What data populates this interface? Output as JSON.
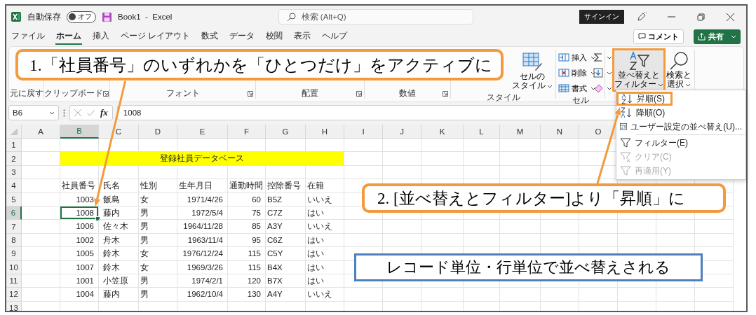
{
  "title_bar": {
    "autosave": {
      "label": "自動保存",
      "on": false,
      "state": "オフ"
    },
    "document_title": "Book1  -  Excel",
    "search": {
      "placeholder": "検索 (Alt+Q)"
    },
    "sign_in": "サインイン"
  },
  "menu_tabs": [
    {
      "label": "ファイル",
      "selected": false
    },
    {
      "label": "ホーム",
      "selected": true
    },
    {
      "label": "挿入",
      "selected": false
    },
    {
      "label": "ページ レイアウト",
      "selected": false
    },
    {
      "label": "数式",
      "selected": false
    },
    {
      "label": "データ",
      "selected": false
    },
    {
      "label": "校閲",
      "selected": false
    },
    {
      "label": "表示",
      "selected": false
    },
    {
      "label": "ヘルプ",
      "selected": false
    }
  ],
  "actions": {
    "comment": "コメント",
    "share": "共有"
  },
  "ribbon": {
    "groups": [
      {
        "label": "元に戻す",
        "launcher": false
      },
      {
        "label": "クリップボード",
        "launcher": true
      },
      {
        "label": "フォント",
        "launcher": true
      },
      {
        "label": "配置",
        "launcher": true
      },
      {
        "label": "数値",
        "launcher": true
      },
      {
        "label": "スタイル",
        "launcher": false,
        "commands": [
          {
            "kind": "large",
            "lines": [
              "セルの",
              "スタイル"
            ],
            "highlighted": false
          }
        ]
      },
      {
        "label": "セル",
        "launcher": false,
        "commands": [
          {
            "kind": "small",
            "label": "挿入",
            "highlighted": false
          },
          {
            "kind": "small",
            "label": "削除",
            "highlighted": false
          },
          {
            "kind": "small",
            "label": "書式",
            "highlighted": false
          }
        ]
      },
      {
        "launcher": false,
        "commands": [
          {
            "kind": "small",
            "highlighted": false
          },
          {
            "kind": "small",
            "highlighted": false
          },
          {
            "kind": "small",
            "highlighted": false
          },
          {
            "kind": "large",
            "lines": [
              "並べ替えと",
              "フィルター"
            ],
            "highlighted": true
          },
          {
            "kind": "large",
            "lines": [
              "検索と",
              "選択"
            ],
            "highlighted": false
          }
        ]
      }
    ]
  },
  "formula_bar": {
    "name_box": "B6",
    "function_label": "fx",
    "value": "1008"
  },
  "sheet": {
    "columns": [
      {
        "label": "A",
        "selected": false
      },
      {
        "label": "B",
        "selected": true
      },
      {
        "label": "C",
        "selected": false
      },
      {
        "label": "D",
        "selected": false
      },
      {
        "label": "E",
        "selected": false
      },
      {
        "label": "F",
        "selected": false
      },
      {
        "label": "G",
        "selected": false
      },
      {
        "label": "H",
        "selected": false
      },
      {
        "label": "I",
        "selected": false
      },
      {
        "label": "J",
        "selected": false
      },
      {
        "label": "K",
        "selected": false
      },
      {
        "label": "L",
        "selected": false
      },
      {
        "label": "M",
        "selected": false
      },
      {
        "label": "N",
        "selected": false
      },
      {
        "label": "O",
        "selected": false
      }
    ],
    "rows": [
      {
        "number": "1",
        "kind": "blank",
        "selected": false
      },
      {
        "number": "2",
        "kind": "title",
        "selected": false,
        "text": "登録社員データベース"
      },
      {
        "number": "3",
        "kind": "blank",
        "selected": false
      },
      {
        "number": "4",
        "kind": "header",
        "selected": false,
        "cells": [
          "社員番号",
          "氏名",
          "性別",
          "生年月日",
          "通勤時間",
          "控除番号",
          "在籍"
        ]
      },
      {
        "number": "5",
        "kind": "record",
        "selected": false,
        "cells": [
          "1003",
          "飯島",
          "女",
          "1971/4/26",
          "60",
          "B5Z",
          "いいえ"
        ]
      },
      {
        "number": "6",
        "kind": "record",
        "selected": true,
        "cells": [
          "1008",
          "藤内",
          "男",
          "1972/5/4",
          "75",
          "C7Z",
          "はい"
        ]
      },
      {
        "number": "7",
        "kind": "record",
        "selected": false,
        "cells": [
          "1006",
          "佐々木",
          "男",
          "1964/11/28",
          "85",
          "A3Y",
          "いいえ"
        ]
      },
      {
        "number": "8",
        "kind": "record",
        "selected": false,
        "cells": [
          "1002",
          "舟木",
          "男",
          "1963/11/4",
          "95",
          "C6Z",
          "はい"
        ]
      },
      {
        "number": "9",
        "kind": "record",
        "selected": false,
        "cells": [
          "1005",
          "鈴木",
          "女",
          "1976/12/24",
          "115",
          "C5Y",
          "はい"
        ]
      },
      {
        "number": "10",
        "kind": "record",
        "selected": false,
        "cells": [
          "1007",
          "鈴木",
          "女",
          "1969/3/26",
          "115",
          "B4X",
          "はい"
        ]
      },
      {
        "number": "11",
        "kind": "record",
        "selected": false,
        "cells": [
          "1001",
          "小笠原",
          "男",
          "1974/2/1",
          "120",
          "B7X",
          "はい"
        ]
      },
      {
        "number": "12",
        "kind": "record",
        "selected": false,
        "cells": [
          "1004",
          "藤内",
          "男",
          "1962/10/4",
          "130",
          "A4Y",
          "いいえ"
        ]
      },
      {
        "number": "13",
        "kind": "blank",
        "selected": false
      }
    ]
  },
  "sort_menu": {
    "items": [
      {
        "label": "昇順(S)",
        "highlighted": true,
        "disabled": false
      },
      {
        "label": "降順(O)",
        "highlighted": false,
        "disabled": false
      },
      {
        "label": "ユーザー設定の並べ替え(U)...",
        "highlighted": false,
        "disabled": false
      },
      {
        "label": "フィルター(E)",
        "highlighted": false,
        "disabled": false
      },
      {
        "label": "クリア(C)",
        "highlighted": false,
        "disabled": true
      },
      {
        "label": "再適用(Y)",
        "highlighted": false,
        "disabled": true
      }
    ]
  },
  "callouts": [
    {
      "kind": "step",
      "text": "1.「社員番号」のいずれかを「ひとつだけ」をアクティブに"
    },
    {
      "kind": "step",
      "text": "2. [並べ替えとフィルター]より「昇順」に"
    },
    {
      "kind": "note",
      "text": "レコード単位・行単位で並べ替えされる"
    }
  ]
}
